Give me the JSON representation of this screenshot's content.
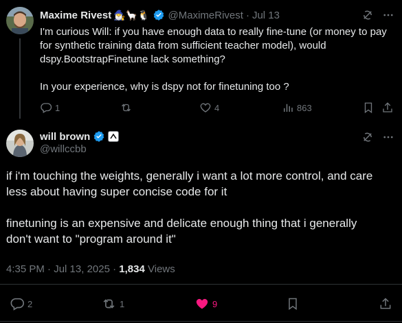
{
  "reply_tweet": {
    "author_name": "Maxime Rivest",
    "author_emoji": "🧙‍♂️🦙🐧",
    "handle": "@MaximeRivest",
    "separator": "·",
    "date": "Jul 13",
    "text_line1": "I'm curious Will: if you have enough data to really fine-tune (or money to pay",
    "text_line2": "for synthetic training data from sufficient teacher model), would",
    "text_line3": "dspy.BootstrapFinetune lack something?",
    "text_line4": "In your experience, why is dspy not for finetuning too ?",
    "replies": "1",
    "reposts": "",
    "likes": "4",
    "views": "863"
  },
  "main_tweet": {
    "author_name": "will brown",
    "handle": "@willccbb",
    "text_p1_line1": "if i'm touching the weights, generally i want a lot more control, and care",
    "text_p1_line2": "less about having super concise code for it",
    "text_p2_line1": "finetuning is an expensive and delicate enough thing that i generally",
    "text_p2_line2": "don't want to \"program around it\"",
    "time": "4:35 PM",
    "date": "Jul 13, 2025",
    "views_count": "1,834",
    "views_label": "Views",
    "replies": "2",
    "reposts": "1",
    "likes": "9"
  },
  "colors": {
    "background": "#000000",
    "text": "#e7e9ea",
    "muted": "#71767b",
    "verified": "#1d9bf0",
    "like": "#f91880",
    "divider": "#2f3336"
  },
  "icons": [
    "grok-icon",
    "more-icon",
    "reply-icon",
    "repost-icon",
    "like-icon",
    "views-icon",
    "bookmark-icon",
    "share-icon",
    "verified-icon",
    "affiliate-badge-icon"
  ]
}
